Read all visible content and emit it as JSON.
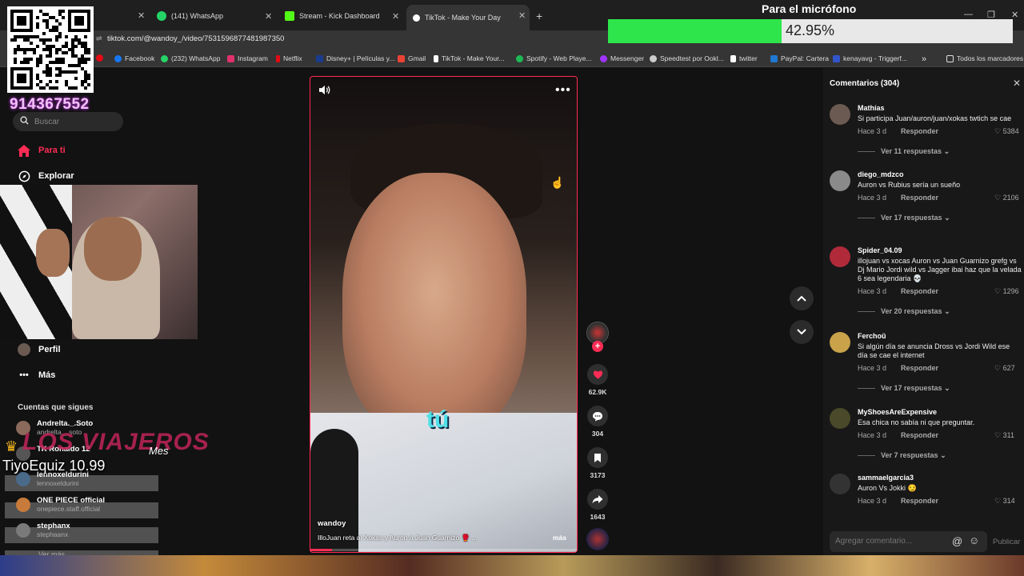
{
  "browser": {
    "tabs": [
      {
        "label": "(141) WhatsApp",
        "color": "#25d366"
      },
      {
        "label": "Stream - Kick Dashboard",
        "color": "#53fc18"
      },
      {
        "label": "TikTok - Make Your Day",
        "color": "#ffffff"
      }
    ],
    "url": "tiktok.com/@wandoy_/video/7531596877481987350",
    "bookmarks": [
      {
        "label": "Facebook",
        "color": "#1877f2"
      },
      {
        "label": "(232) WhatsApp",
        "color": "#25d366"
      },
      {
        "label": "Instagram",
        "color": "#e1306c"
      },
      {
        "label": "Netflix",
        "color": "#e50914"
      },
      {
        "label": "Disney+ | Películas y...",
        "color": "#1a3c8f"
      },
      {
        "label": "Gmail",
        "color": "#ea4335"
      },
      {
        "label": "TikTok - Make Your...",
        "color": "#ffffff"
      },
      {
        "label": "Spotify - Web Playe...",
        "color": "#1db954"
      },
      {
        "label": "Messenger",
        "color": "#a033ff"
      },
      {
        "label": "Speedtest por Ookl...",
        "color": "#cccccc"
      },
      {
        "label": "twitter",
        "color": "#ffffff"
      },
      {
        "label": "PayPal: Cartera",
        "color": "#1f78d1"
      },
      {
        "label": "kenayavg - Triggerf...",
        "color": "#3355cc"
      }
    ],
    "all_bookmarks": "Todos los marcadores"
  },
  "overlay": {
    "mic_title": "Para el micrófono",
    "mic_percent": "42.95%",
    "mic_fraction": 0.4295,
    "qr_number": "914367552",
    "donor": "TiyoEquiz 10.99",
    "brand": "LOS VIAJEROS",
    "brand_sub": "Mes"
  },
  "sidebar": {
    "search_placeholder": "Buscar",
    "nav": [
      {
        "label": "Para ti"
      },
      {
        "label": "Explorar"
      },
      {
        "label": "Perfil"
      },
      {
        "label": "Más"
      }
    ],
    "following_title": "Cuentas que sigues",
    "following": [
      {
        "name": "Andrelta._.Soto",
        "handle": "andrelta._.soto"
      },
      {
        "name": "TK Ronaldo 12",
        "handle": ""
      },
      {
        "name": "lennoxeldurini",
        "handle": "lennoxeldurini"
      },
      {
        "name": "ONE PIECE official",
        "handle": "onepiece.staff.official"
      },
      {
        "name": "stephanx",
        "handle": "stephaanx"
      }
    ],
    "ver_mas": "Ver más"
  },
  "video": {
    "caption_overlay": "tú",
    "username": "wandoy",
    "caption": "IlloJuan reta al Xokas y Auron a Juan Guarnizo 🥊 ...",
    "more": "más",
    "progress": 0.08
  },
  "actions": {
    "likes": "62.9K",
    "comments": "304",
    "saves": "3173",
    "shares": "1643"
  },
  "comments_panel": {
    "title": "Comentarios (304)",
    "input_placeholder": "Agregar comentario...",
    "post_label": "Publicar",
    "items": [
      {
        "user": "Mathías",
        "text": "Si participa Juan/auron/juan/xokas twtich se cae",
        "time": "Hace 3 d",
        "reply": "Responder",
        "likes": "5384",
        "view": "Ver 11 respuestas",
        "color": "#6b5a52"
      },
      {
        "user": "diego_mdzco",
        "text": "Auron vs Rubius sería un sueño",
        "time": "Hace 3 d",
        "reply": "Responder",
        "likes": "2106",
        "view": "Ver 17 respuestas",
        "color": "#8a8a8a"
      },
      {
        "user": "Spider_04.09",
        "text": "illojuan vs xocas Auron vs Juan Guarnizo grefg vs Dj Mario Jordi wild vs Jagger ibai haz que la velada 6 sea legendaria 💀",
        "time": "Hace 3 d",
        "reply": "Responder",
        "likes": "1296",
        "view": "Ver 20 respuestas",
        "color": "#b02a3a"
      },
      {
        "user": "Ferchoŭ",
        "text": "Si algún día se anuncia Dross vs Jordi Wild ese día se cae el internet",
        "time": "Hace 3 d",
        "reply": "Responder",
        "likes": "627",
        "view": "Ver 17 respuestas",
        "color": "#c9a24a"
      },
      {
        "user": "MyShoesAreExpensive",
        "text": "Esa chica no sabía ni que preguntar.",
        "time": "Hace 3 d",
        "reply": "Responder",
        "likes": "311",
        "view": "Ver 7 respuestas",
        "color": "#4a4a2a"
      },
      {
        "user": "sammaelgarcia3",
        "text": "Auron Vs Jokki 😏",
        "time": "Hace 3 d",
        "reply": "Responder",
        "likes": "314",
        "view": "",
        "color": "#333333"
      }
    ]
  }
}
